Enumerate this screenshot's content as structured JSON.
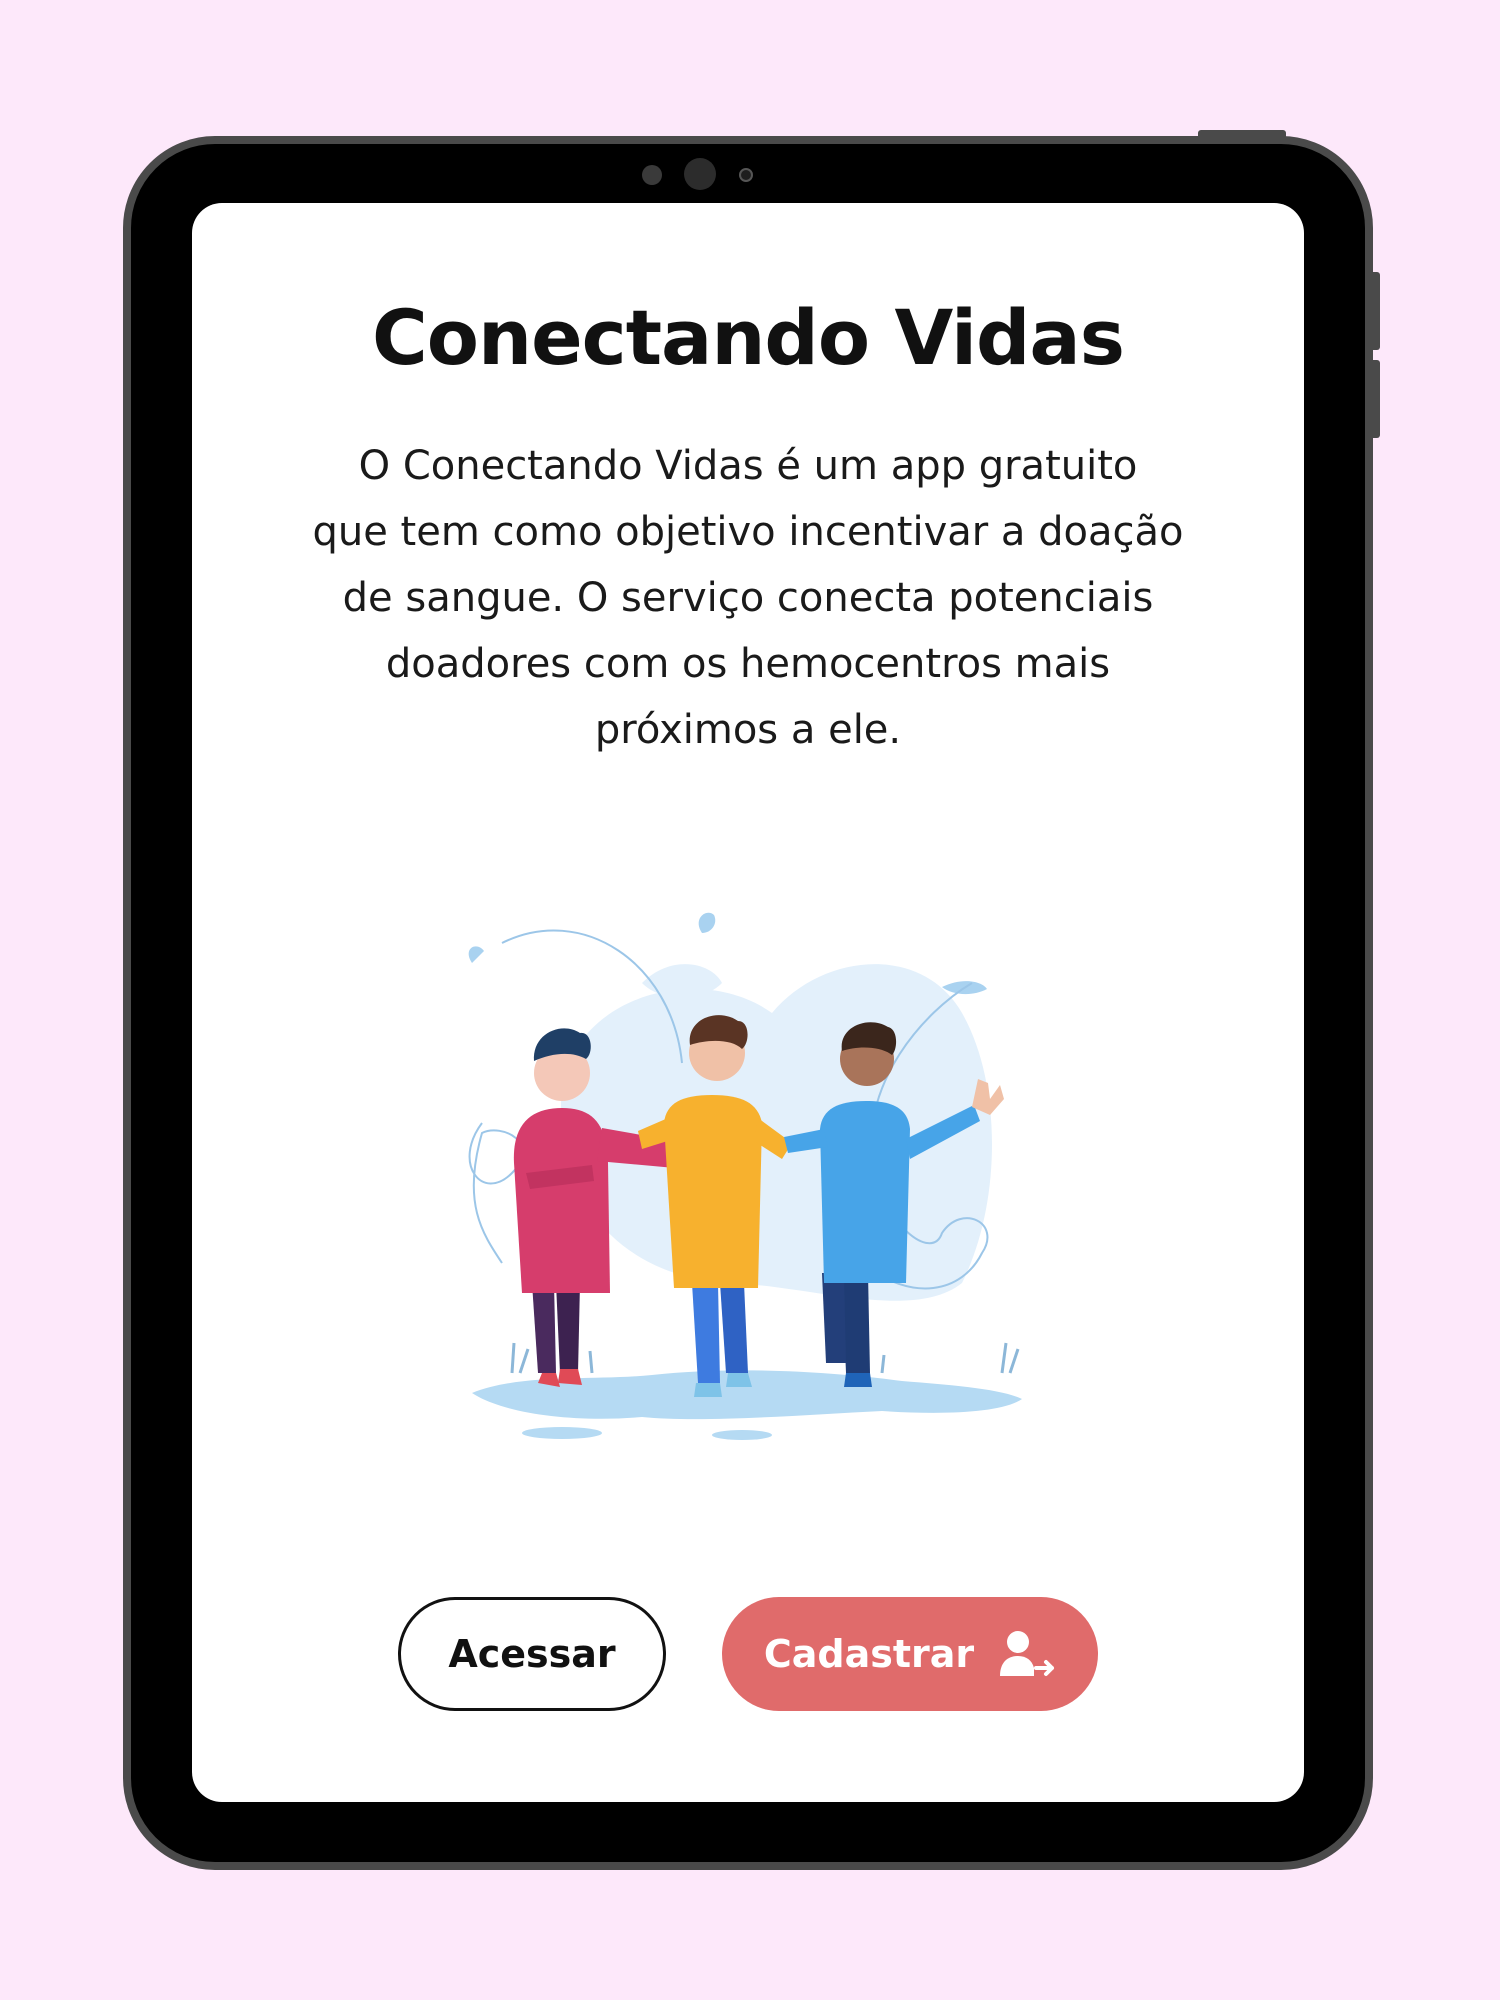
{
  "colors": {
    "background": "#fde8fa",
    "accent": "#e06b6b",
    "text": "#111111"
  },
  "screen": {
    "title": "Conectando Vidas",
    "description_lines": [
      "O Conectando Vidas é um app gratuito",
      "que tem como objetivo incentivar a doação",
      "de sangue. O serviço conecta potenciais",
      "doadores com os hemocentros mais",
      "próximos a ele."
    ]
  },
  "buttons": {
    "login_label": "Acessar",
    "register_label": "Cadastrar",
    "register_icon": "add-user-icon"
  },
  "illustration": {
    "icon": "friends-walking-illustration"
  }
}
